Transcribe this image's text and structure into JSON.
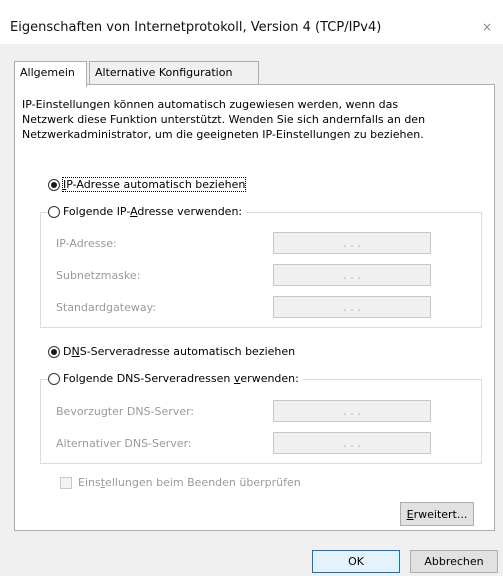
{
  "window": {
    "title": "Eigenschaften von Internetprotokoll, Version 4 (TCP/IPv4)",
    "close_glyph": "×"
  },
  "tabs": [
    {
      "label": "Allgemein",
      "active": true
    },
    {
      "label": "Alternative Konfiguration",
      "active": false
    }
  ],
  "intro_text": "IP-Einstellungen können automatisch zugewiesen werden, wenn das\nNetzwerk diese Funktion unterstützt. Wenden Sie sich andernfalls an den\nNetzwerkadministrator, um die geeigneten IP-Einstellungen zu beziehen.",
  "ip_section": {
    "auto": {
      "mnemonic": "I",
      "rest": "P-Adresse automatisch beziehen",
      "checked": true
    },
    "manual": {
      "pre": "Folgende IP-",
      "mnemonic": "A",
      "rest": "dresse verwenden:",
      "checked": false
    },
    "fields": [
      {
        "label": "IP-Adresse:",
        "value": ". . ."
      },
      {
        "label": "Subnetzmaske:",
        "value": ". . ."
      },
      {
        "label": "Standardgateway:",
        "value": ". . ."
      }
    ]
  },
  "dns_section": {
    "auto": {
      "pre": "D",
      "mnemonic": "N",
      "rest": "S-Serveradresse automatisch beziehen",
      "checked": true
    },
    "manual": {
      "pre": "Folgende DNS-Serveradressen ",
      "mnemonic": "v",
      "rest": "erwenden:",
      "checked": false
    },
    "fields": [
      {
        "label": "Bevorzugter DNS-Server:",
        "value": ". . ."
      },
      {
        "label": "Alternativer DNS-Server:",
        "value": ". . ."
      }
    ]
  },
  "validate_checkbox": {
    "pre": "Eins",
    "mnemonic": "t",
    "rest": "ellungen beim Beenden überprüfen",
    "checked": false
  },
  "buttons": {
    "advanced": {
      "mnemonic": "E",
      "rest": "rweitert..."
    },
    "ok": "OK",
    "cancel": "Abbrechen"
  },
  "colors": {
    "default_button_border": "#0078d7",
    "disabled_text": "#9a9a9a"
  }
}
